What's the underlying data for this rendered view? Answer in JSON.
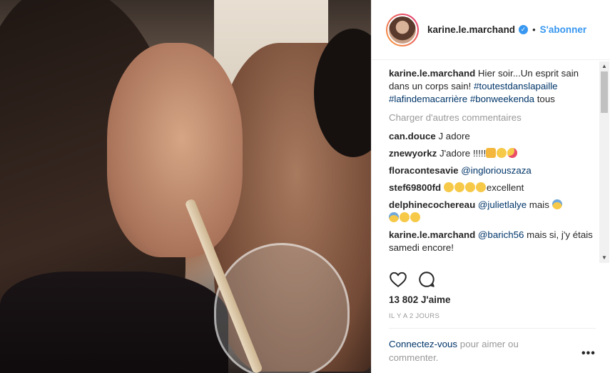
{
  "post": {
    "username": "karine.le.marchand",
    "verified_icon": "verified-check-icon",
    "separator": "•",
    "follow_label": "S'abonner"
  },
  "caption": {
    "user": "karine.le.marchand",
    "text": "Hier soir...Un esprit sain dans un corps sain!",
    "tags": [
      "#toutestdanslapaille",
      "#lafindemacarrière",
      "#bonweekenda"
    ],
    "tail": "tous"
  },
  "load_more": "Charger d'autres commentaires",
  "comments": [
    {
      "user": "can.douce",
      "text": "J adore"
    },
    {
      "user": "znewyorkz",
      "text": "J'adore !!!!!"
    },
    {
      "user": "floracontesavie",
      "mention": "@ingloriouszaza"
    },
    {
      "user": "stef69800fd",
      "text": "excellent"
    },
    {
      "user": "delphinecochereau",
      "mention": "@julietlalye",
      "text": "mais"
    },
    {
      "user": "karine.le.marchand",
      "mention": "@barich56",
      "text": "mais si, j'y étais samedi encore!"
    }
  ],
  "likes": "13 802 J'aime",
  "time": "IL Y A 2 JOURS",
  "login": {
    "link": "Connectez-vous",
    "text": "pour aimer ou commenter."
  },
  "more_label": "•••",
  "icons": [
    "heart-icon",
    "comment-icon",
    "more-icon"
  ],
  "colors": {
    "accent": "#3897f0",
    "link": "#003569",
    "muted": "#999999"
  }
}
